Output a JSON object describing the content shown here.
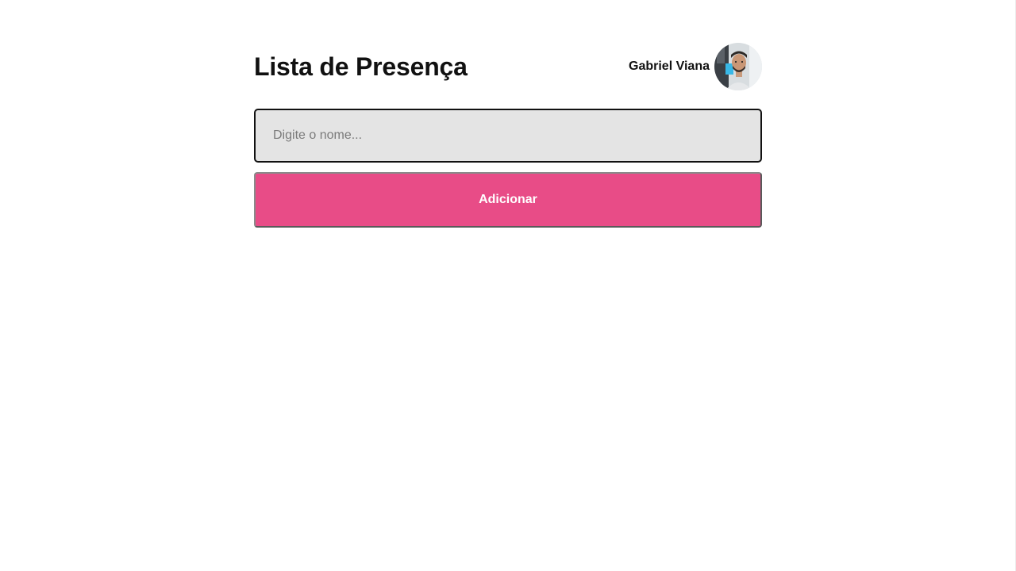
{
  "header": {
    "title": "Lista de Presença",
    "user": {
      "name": "Gabriel Viana",
      "avatar_icon": "user-avatar-photo"
    }
  },
  "form": {
    "name_input": {
      "placeholder": "Digite o nome...",
      "value": ""
    },
    "add_button_label": "Adicionar"
  },
  "colors": {
    "accent": "#e84c87",
    "input_background": "#e4e4e4",
    "text": "#111111",
    "page_background": "#ffffff"
  }
}
